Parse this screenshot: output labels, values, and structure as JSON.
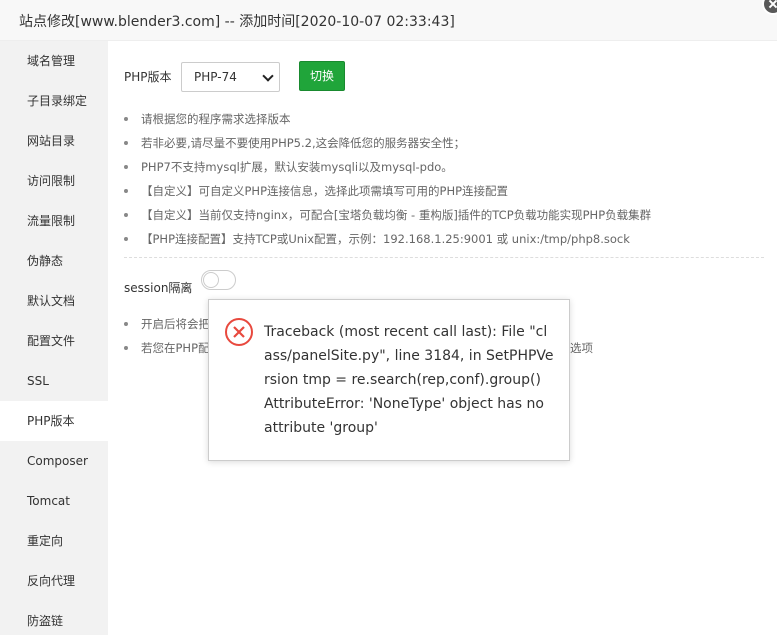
{
  "window": {
    "title": "站点修改[www.blender3.com] -- 添加时间[2020-10-07 02:33:43]"
  },
  "sidebar": {
    "items": [
      {
        "label": "域名管理"
      },
      {
        "label": "子目录绑定"
      },
      {
        "label": "网站目录"
      },
      {
        "label": "访问限制"
      },
      {
        "label": "流量限制"
      },
      {
        "label": "伪静态"
      },
      {
        "label": "默认文档"
      },
      {
        "label": "配置文件"
      },
      {
        "label": "SSL"
      },
      {
        "label": "PHP版本"
      },
      {
        "label": "Composer"
      },
      {
        "label": "Tomcat"
      },
      {
        "label": "重定向"
      },
      {
        "label": "反向代理"
      },
      {
        "label": "防盗链"
      }
    ],
    "active_index": 9
  },
  "php": {
    "label": "PHP版本",
    "selected": "PHP-74",
    "switch_label": "切换"
  },
  "tips": [
    "请根据您的程序需求选择版本",
    "若非必要,请尽量不要使用PHP5.2,这会降低您的服务器安全性；",
    "PHP7不支持mysql扩展，默认安装mysqli以及mysql-pdo。",
    "【自定义】可自定义PHP连接信息，选择此项需填写可用的PHP连接配置",
    "【自定义】当前仅支持nginx，可配合[宝塔负载均衡 - 重构版]插件的TCP负载功能实现PHP负载集群",
    "【PHP连接配置】支持TCP或Unix配置，示例：192.168.1.25:9001 或 unix:/tmp/php8.sock"
  ],
  "session": {
    "label": "session隔离",
    "enabled": false,
    "tips": [
      "开启后将会把",
      "若您在PHP配",
      "选项"
    ]
  },
  "error_dialog": {
    "message": "Traceback (most recent call last): File \"class/panelSite.py\", line 3184, in SetPHPVersion tmp = re.search(rep,conf).group() AttributeError: 'NoneType' object has no attribute 'group'",
    "icon": "error-circle-x-icon",
    "color": "#e8493e"
  },
  "colors": {
    "accent": "#20a53a",
    "sidebar_bg": "#f2f2f2"
  }
}
